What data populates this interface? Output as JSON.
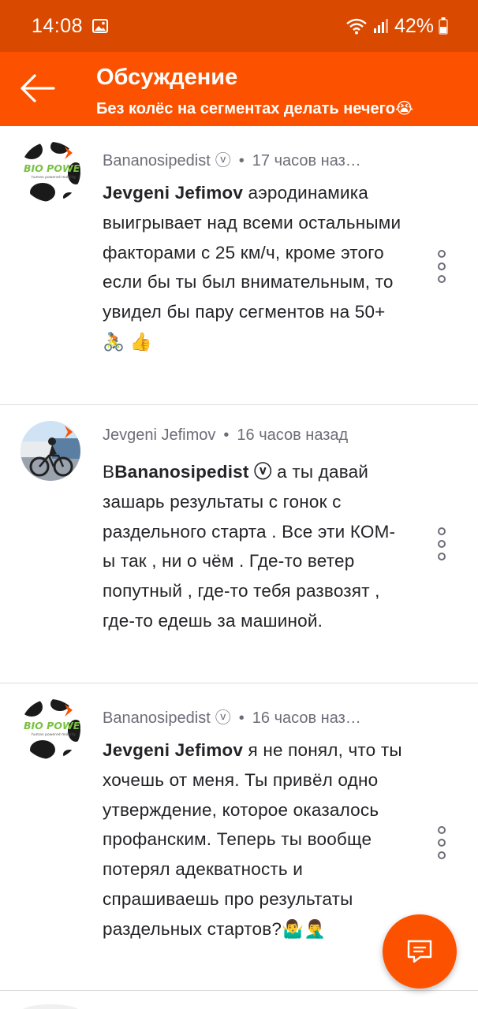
{
  "status_bar": {
    "time": "14:08",
    "battery": "42%",
    "icons": [
      "gallery-icon",
      "wifi-icon",
      "signal-icon",
      "battery-icon"
    ]
  },
  "header": {
    "title": "Обсуждение",
    "subtitle": "Без колёс на сегментах делать нечего😭",
    "back_icon": "arrow-left-icon"
  },
  "colors": {
    "brand": "#fc5200",
    "status_bar": "#d94a00",
    "text": "#242428",
    "meta": "#6d6d78",
    "divider": "#dcdcdc"
  },
  "comments": [
    {
      "author": "Bananosipedist",
      "verified": "ⓥ",
      "separator": "•",
      "time": "17 часов наз…",
      "avatar": "bio-power-logo",
      "mention": "Jevgeni Jefimov",
      "prefix": "",
      "text": " аэродинамика выигрывает над всеми остальными факторами с 25 км/ч, кроме этого если бы ты был внимательным, то увидел бы пару сегментов на 50+ 🚴 👍"
    },
    {
      "author": "Jevgeni Jefimov",
      "verified": "",
      "separator": "•",
      "time": "16 часов назад",
      "avatar": "cyclist-photo",
      "mention": "Bananosipedist ⓥ",
      "prefix": "В",
      "text": "  а ты давай зашарь результаты с гонок с раздельного старта . Все эти КОМ-ы так , ни о чём . Где-то ветер попутный , где-то тебя развозят , где-то едешь за машиной."
    },
    {
      "author": "Bananosipedist",
      "verified": "ⓥ",
      "separator": "•",
      "time": "16 часов наз…",
      "avatar": "bio-power-logo",
      "mention": "Jevgeni Jefimov",
      "prefix": "",
      "text": " я не понял, что ты хочешь от меня. Ты привёл одно утверждение, которое оказалось профанским. Теперь ты вообще потерял адекватность и спрашиваешь про результаты раздельных стартов?🤷‍♂️🤦‍♂️"
    }
  ],
  "fab": {
    "icon": "comment-icon"
  }
}
